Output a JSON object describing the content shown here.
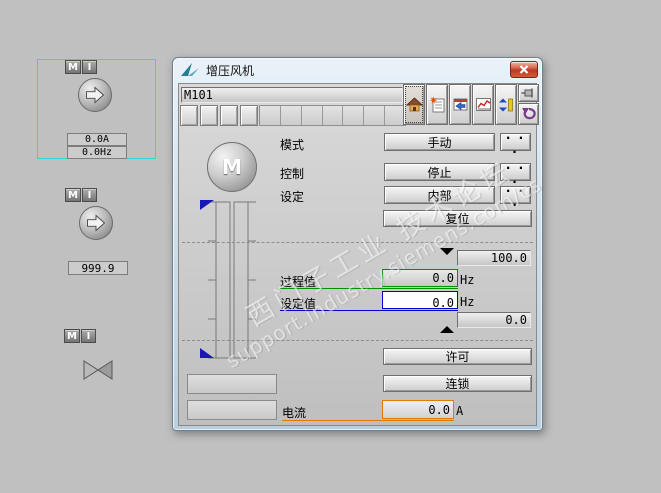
{
  "window": {
    "title": "增压风机"
  },
  "faceplate": {
    "tag": "M101",
    "toolbar_icons": [
      "home-icon",
      "alarm-list-icon",
      "message-icon",
      "trend-icon",
      "limits-icon",
      "pin-icon",
      "undo-icon"
    ],
    "motor_symbol": "M",
    "mode_row": {
      "label": "模式",
      "value": "手动",
      "more": ". . ."
    },
    "control_row": {
      "label": "控制",
      "value": "停止",
      "more": ". . ."
    },
    "setting_row": {
      "label": "设定",
      "value": "内部",
      "more": ". . ."
    },
    "reset": "复位",
    "high_limit": "100.0",
    "process_value": {
      "label": "过程值",
      "value": "0.0",
      "unit": "Hz"
    },
    "setpoint": {
      "label": "设定值",
      "value": "0.0",
      "unit": "Hz"
    },
    "low_limit": "0.0",
    "permit": "许可",
    "interlock": "连锁",
    "current": {
      "label": "电流",
      "value": "0.0",
      "unit": "A"
    }
  },
  "plant_symbols": {
    "motor1": {
      "m": "M",
      "i": "I",
      "line1": "0.0A",
      "line2": "0.0Hz"
    },
    "motor2": {
      "m": "M",
      "i": "I",
      "value": "999.9"
    },
    "valve": {
      "m": "M",
      "i": "I"
    }
  },
  "watermark": {
    "line1": "西门子工业 技术论坛",
    "line2": "support.industry.siemens.com/cs"
  },
  "colors": {
    "selection": "#2fd8d8",
    "process_border": "#009000",
    "setpoint_border": "#0000cc",
    "current_border": "#e07b00",
    "close_button": "#bb3a26"
  }
}
